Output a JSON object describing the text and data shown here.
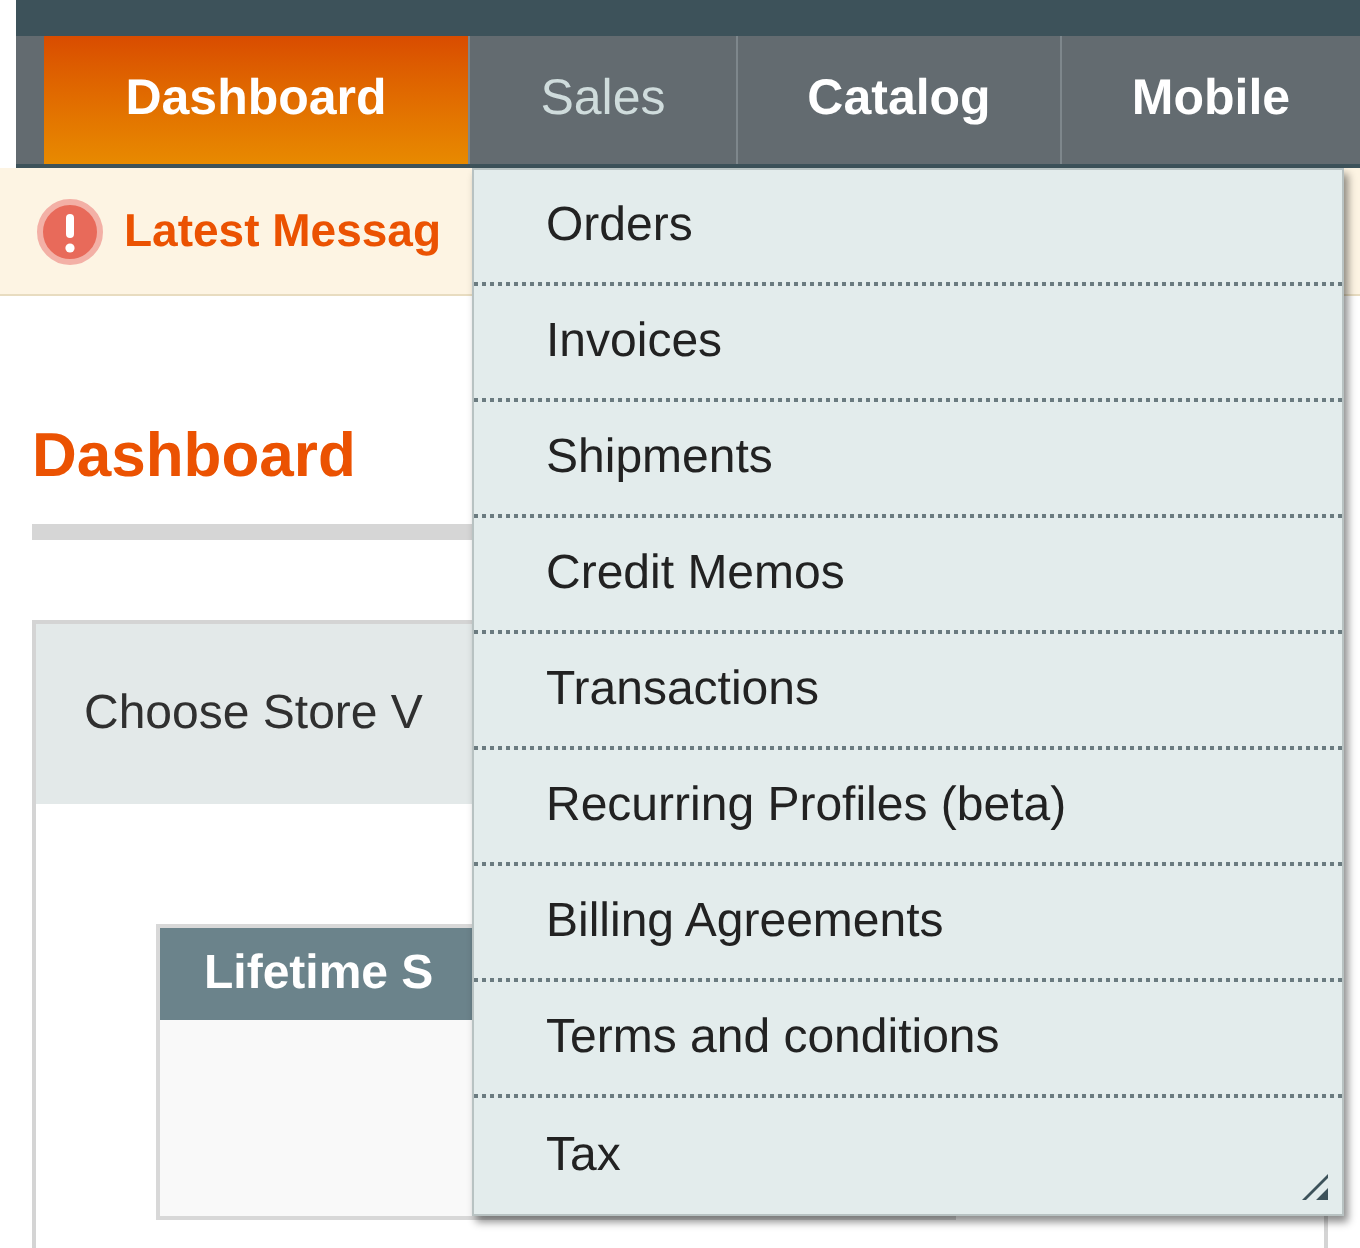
{
  "nav": [
    {
      "label": "Dashboard",
      "selected": true,
      "expanded": false
    },
    {
      "label": "Sales",
      "selected": false,
      "expanded": true
    },
    {
      "label": "Catalog",
      "selected": false,
      "expanded": false
    },
    {
      "label": "Mobile",
      "selected": false,
      "expanded": false
    }
  ],
  "message_bar": {
    "text": "Latest Messag"
  },
  "page_title": "Dashboard",
  "store_switcher": {
    "label": "Choose Store V"
  },
  "lifetime_panel": {
    "title": "Lifetime S"
  },
  "sales_menu": [
    "Orders",
    "Invoices",
    "Shipments",
    "Credit Memos",
    "Transactions",
    "Recurring Profiles (beta)",
    "Billing Agreements",
    "Terms and conditions",
    "Tax"
  ]
}
